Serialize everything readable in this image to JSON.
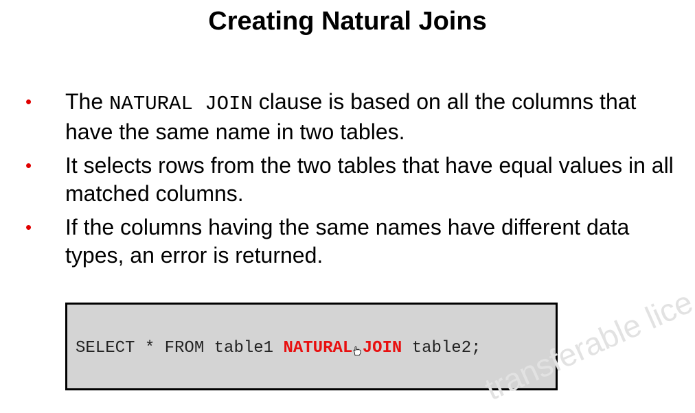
{
  "slide": {
    "title": "Creating Natural Joins"
  },
  "bullets": [
    {
      "pre": "The ",
      "code": "NATURAL JOIN",
      "post": " clause is based on all the columns that have the same name in two tables."
    },
    {
      "text": "It selects rows from the two tables that have equal values in all matched columns."
    },
    {
      "text": "If the columns having the same names have different data types, an error is returned."
    }
  ],
  "code_example": {
    "prefix": "SELECT * FROM table1 ",
    "keyword1": "NATURAL",
    "space": " ",
    "keyword2": "JOIN",
    "suffix": " table2;"
  },
  "watermark": "transferable lice",
  "colors": {
    "bullet": "#e00000",
    "keyword": "#e81010",
    "code_background": "#d4d4d4"
  }
}
